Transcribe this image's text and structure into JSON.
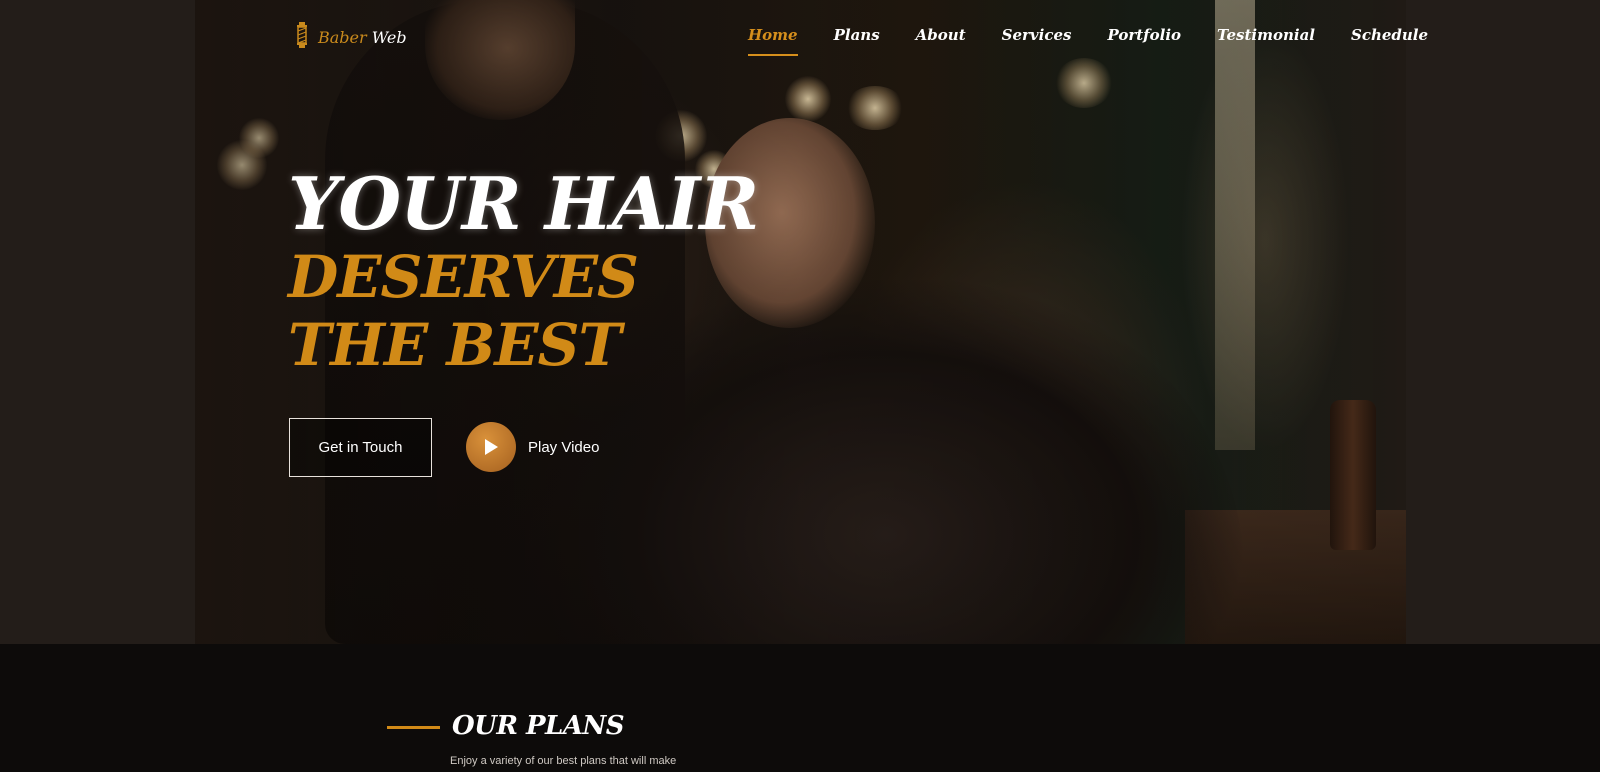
{
  "brand": {
    "name_part1": "Baber",
    "name_part2": "Web"
  },
  "nav": {
    "items": [
      {
        "label": "Home",
        "active": true
      },
      {
        "label": "Plans"
      },
      {
        "label": "About"
      },
      {
        "label": "Services"
      },
      {
        "label": "Portfolio"
      },
      {
        "label": "Testimonial"
      },
      {
        "label": "Schedule"
      }
    ]
  },
  "hero": {
    "line1": "YOUR HAIR",
    "line2": "DESERVES",
    "line3": "THE BEST",
    "cta_label": "Get in Touch",
    "play_label": "Play Video"
  },
  "plans": {
    "title": "OUR PLANS",
    "subtitle": "Enjoy a variety of our best plans that will make"
  },
  "colors": {
    "accent": "#d18a17",
    "background": "#0d0b0a"
  }
}
